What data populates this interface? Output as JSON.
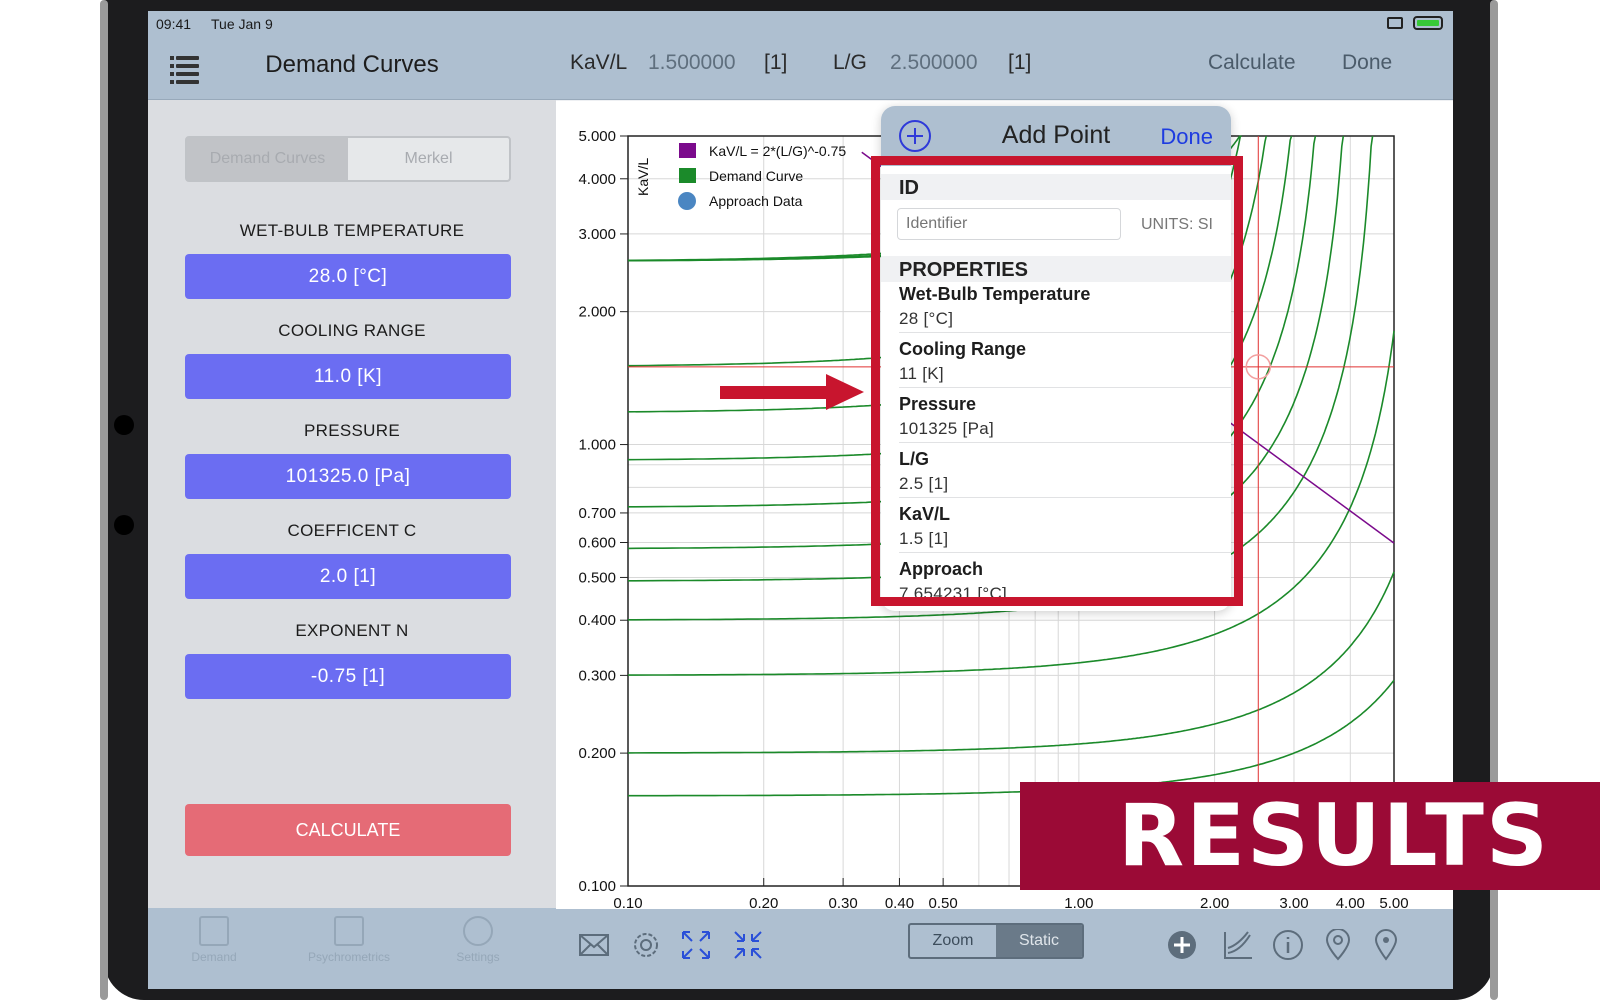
{
  "status": {
    "time": "09:41",
    "date": "Tue Jan 9"
  },
  "sidebar": {
    "title": "Demand Curves",
    "segments": [
      "Demand Curves",
      "Merkel"
    ],
    "fields": [
      {
        "label": "WET-BULB TEMPERATURE",
        "value": "28.0  [°C]"
      },
      {
        "label": "COOLING RANGE",
        "value": "11.0  [K]"
      },
      {
        "label": "PRESSURE",
        "value": "101325.0  [Pa]"
      },
      {
        "label": "COEFFICENT C",
        "value": "2.0  [1]"
      },
      {
        "label": "EXPONENT N",
        "value": "-0.75  [1]"
      }
    ],
    "calculate_label": "CALCULATE",
    "tabs": [
      "Demand",
      "Psychrometrics",
      "Settings"
    ]
  },
  "header": {
    "kavl_label": "KaV/L",
    "kavl_value": "1.500000",
    "kavl_unit": "[1]",
    "lg_label": "L/G",
    "lg_value": "2.500000",
    "lg_unit": "[1]",
    "calculate": "Calculate",
    "done": "Done"
  },
  "chart_data": {
    "type": "line",
    "x_scale": "log",
    "y_scale": "log",
    "xlim": [
      0.1,
      5.0
    ],
    "ylim": [
      0.1,
      5.0
    ],
    "ylabel": "KaV/L",
    "x_ticks": [
      "0.10",
      "0.20",
      "0.30",
      "0.40",
      "0.50",
      "1.00",
      "2.00",
      "3.00",
      "4.00",
      "5.00"
    ],
    "x_tick_values": [
      0.1,
      0.2,
      0.3,
      0.4,
      0.5,
      1.0,
      2.0,
      3.0,
      4.0,
      5.0
    ],
    "y_ticks": [
      "5.000",
      "4.000",
      "3.000",
      "2.000",
      "1.000",
      "0.700",
      "0.600",
      "0.500",
      "0.400",
      "0.300",
      "0.200",
      "0.100"
    ],
    "y_tick_values": [
      5,
      4,
      3,
      2,
      1,
      0.7,
      0.6,
      0.5,
      0.4,
      0.3,
      0.2,
      0.1
    ],
    "legend": [
      "KaV/L = 2*(L/G)^-0.75",
      "Demand Curve",
      "Approach Data"
    ],
    "colors": {
      "purple": "#7b0a8c",
      "green": "#1b8a2a",
      "blue": "#4a86c2",
      "red": "#e03030"
    },
    "demand_curves": [
      {
        "y0": 1.5,
        "asymptote": 2.45
      },
      {
        "y0": 1.18,
        "asymptote": 2.7
      },
      {
        "y0": 0.92,
        "asymptote": 2.95
      },
      {
        "y0": 0.72,
        "asymptote": 3.25
      },
      {
        "y0": 0.58,
        "asymptote": 3.6
      },
      {
        "y0": 0.49,
        "asymptote": 4.1
      },
      {
        "y0": 0.4,
        "asymptote": 4.7
      },
      {
        "y0": 0.3,
        "asymptote": 5.6
      },
      {
        "y0": 0.2,
        "asymptote": 6.8
      },
      {
        "y0": 0.16,
        "asymptote": 8.2
      }
    ],
    "extra_curves": [
      {
        "asymptote": 2.7
      },
      {
        "asymptote": 3.15
      },
      {
        "asymptote": 3.6
      }
    ],
    "merkel_line": {
      "c": 2.0,
      "n": -0.75
    },
    "point": {
      "x": 2.5,
      "y": 1.5
    }
  },
  "toolbar": {
    "zoom": "Zoom",
    "static": "Static"
  },
  "popover": {
    "title": "Add Point",
    "done": "Done",
    "id_header": "ID",
    "id_placeholder": "Identifier",
    "units": "UNITS: SI",
    "properties_header": "PROPERTIES",
    "properties": [
      {
        "name": "Wet-Bulb Temperature",
        "value": "28  [°C]"
      },
      {
        "name": "Cooling Range",
        "value": "11  [K]"
      },
      {
        "name": "Pressure",
        "value": "101325  [Pa]"
      },
      {
        "name": "L/G",
        "value": "2.5  [1]"
      },
      {
        "name": "KaV/L",
        "value": "1.5  [1]"
      },
      {
        "name": "Approach",
        "value": "7.654231  [°C]"
      }
    ]
  },
  "banner": "RESULTS"
}
